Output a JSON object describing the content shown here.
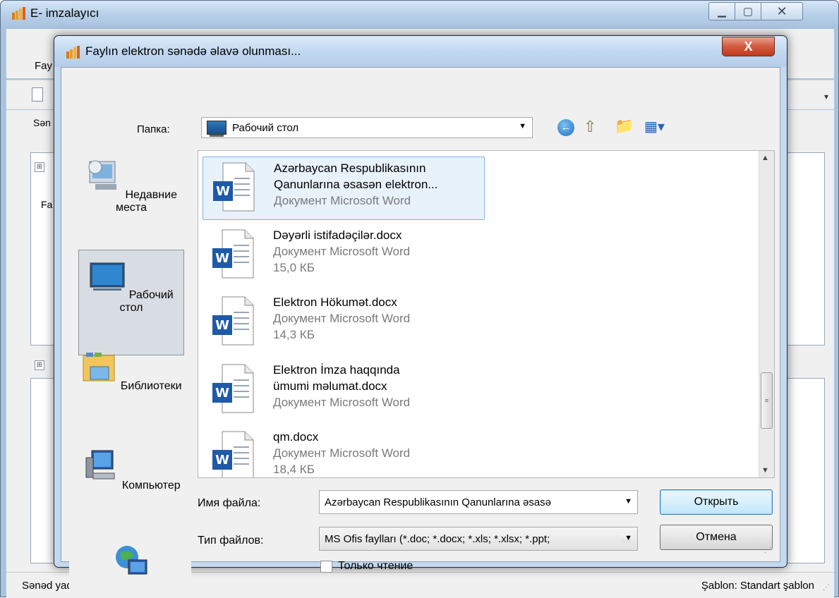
{
  "app": {
    "title": "E- imzalayıcı",
    "menu_file": "Fay",
    "tab_label": "Sən",
    "grid1_header": "Fa",
    "status_left": "Sənəd yadda saxlanılmayıb",
    "status_right": "Şablon: Standart şablon"
  },
  "dialog": {
    "title": "Faylın elektron sənədə əlavə olunması...",
    "close_symbol": "X",
    "lookin": {
      "label": "Папка:",
      "value": "Рабочий стол"
    },
    "places": [
      {
        "label": "Недавние места"
      },
      {
        "label": "Рабочий стол"
      },
      {
        "label": "Библиотеки"
      },
      {
        "label": "Компьютер"
      },
      {
        "label": ""
      }
    ],
    "files": [
      {
        "name_line1": "Azərbaycan Respublikasının",
        "name_line2": "Qanunlarına əsasən elektron...",
        "type": "Документ Microsoft Word",
        "size": ""
      },
      {
        "name_line1": "Dəyərli istifadəçilər.docx",
        "name_line2": "",
        "type": "Документ Microsoft Word",
        "size": "15,0 КБ"
      },
      {
        "name_line1": "Elektron Hökumət.docx",
        "name_line2": "",
        "type": "Документ Microsoft Word",
        "size": "14,3 КБ"
      },
      {
        "name_line1": "Elektron İmza haqqında",
        "name_line2": "ümumi məlumat.docx",
        "type": "Документ Microsoft Word",
        "size": ""
      },
      {
        "name_line1": "qm.docx",
        "name_line2": "",
        "type": "Документ Microsoft Word",
        "size": "18,4 КБ"
      }
    ],
    "filename": {
      "label": "Имя файла:",
      "value": "Azərbaycan Respublikasının Qanunlarına əsasə"
    },
    "filetype": {
      "label": "Тип файлов:",
      "value": "MS Ofis faylları (*.doc; *.docx; *.xls; *.xlsx; *.ppt;"
    },
    "open_label": "Открыть",
    "cancel_label": "Отмена",
    "readonly_label": "Только чтение"
  }
}
